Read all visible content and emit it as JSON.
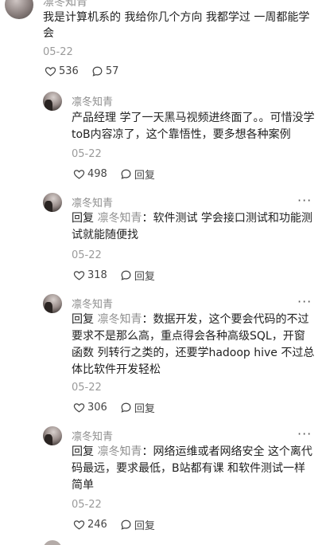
{
  "top_comment": {
    "author": "凛冬知青",
    "text": "我是计算机系的 我给你几个方向 我都学过 一周都能学会",
    "date": "05-22",
    "likes": "536",
    "replies": "57"
  },
  "replies": [
    {
      "author": "凛冬知青",
      "reply_prefix": "",
      "mention": "",
      "text": "产品经理 学了一天黑马视频进终面了。。可惜没学toB内容凉了，这个靠悟性，要多想各种案例",
      "date": "05-22",
      "likes": "498",
      "reply_label": "回复"
    },
    {
      "author": "凛冬知青",
      "reply_prefix": "回复",
      "mention": "凛冬知青",
      "text": "：软件测试 学会接口测试和功能测试就能随便找",
      "date": "05-22",
      "likes": "318",
      "reply_label": "回复"
    },
    {
      "author": "凛冬知青",
      "reply_prefix": "回复",
      "mention": "凛冬知青",
      "text": "：数据开发，这个要会代码的不过要求不是那么高，重点得会各种高级SQL，开窗函数 列转行之类的，还要学hadoop hive 不过总体比软件开发轻松",
      "date": "05-22",
      "likes": "306",
      "reply_label": "回复"
    },
    {
      "author": "凛冬知青",
      "reply_prefix": "回复",
      "mention": "凛冬知青",
      "text": "：网络运维或者网络安全 这个离代码最远，要求最低，B站都有课 和软件测试一样简单",
      "date": "05-22",
      "likes": "246",
      "reply_label": "回复"
    }
  ],
  "icons": {
    "like": "heart-outline-icon",
    "comment": "speech-bubble-icon",
    "more": "more-dots-icon"
  }
}
